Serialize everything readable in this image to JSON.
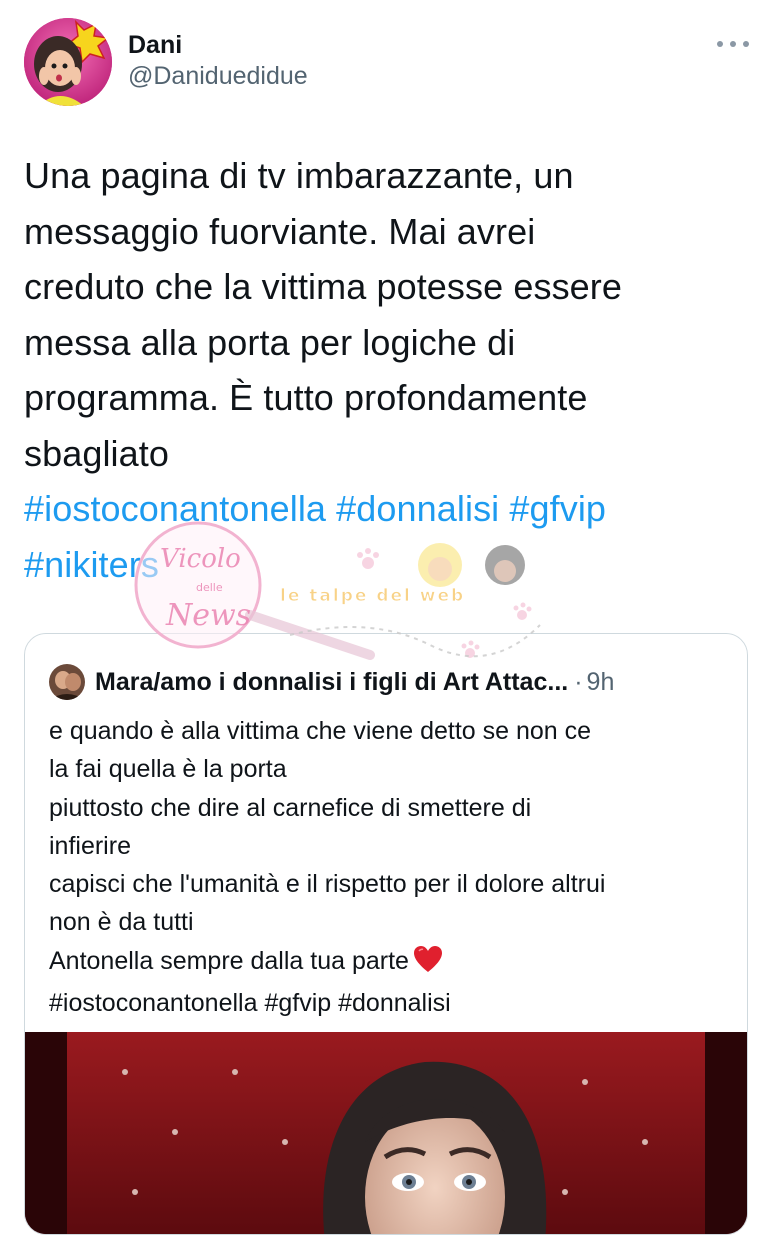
{
  "tweet": {
    "author": {
      "display_name": "Dani",
      "handle": "@Daniduedidue"
    },
    "more_icon": "ellipsis-icon",
    "body_lines": [
      "Una pagina di tv imbarazzante, un",
      "messaggio fuorviante. Mai avrei",
      "creduto che la vittima potesse essere",
      "messa alla porta per logiche di",
      "programma. È tutto profondamente",
      "sbagliato"
    ],
    "hashtags_line1": [
      "#iostoconantonella",
      "#donnalisi",
      "#gfvip"
    ],
    "hashtags_line2": [
      "#nikiters"
    ]
  },
  "quote": {
    "author_name": "Mara/amo i donnalisi i figli di Art Attac...",
    "separator": "·",
    "time": "9h",
    "lines": [
      "e quando è alla vittima che viene detto se non ce",
      "la fai quella è la porta",
      "piuttosto che dire al carnefice di smettere di",
      "infierire",
      "capisci che l'umanità e il rispetto per il dolore altrui",
      "non è da tutti",
      "Antonella sempre dalla tua parte"
    ],
    "hashtags": [
      "#iostoconantonella",
      "#gfvip",
      "#donnalisi"
    ],
    "heart_icon": "red-heart-emoji"
  },
  "watermarks": {
    "circle_text_top": "Vicolo",
    "circle_text_mid": "delle",
    "circle_text_bottom": "News",
    "banner_text": "le talpe del web"
  },
  "colors": {
    "link": "#1d9bf0",
    "secondary": "#536471",
    "border": "#cfd9de"
  }
}
